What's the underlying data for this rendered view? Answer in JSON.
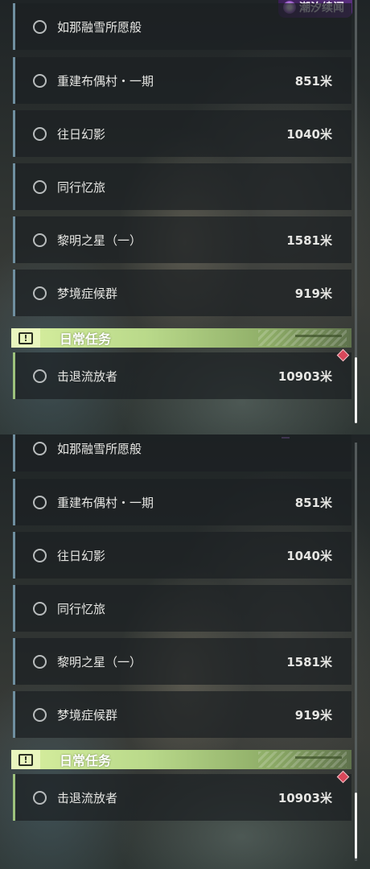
{
  "logo": {
    "text": "潮汐续闻"
  },
  "quests": [
    {
      "name": "如那融雪所愿般",
      "distance": ""
    },
    {
      "name": "重建布偶村・一期",
      "distance": "851米"
    },
    {
      "name": "往日幻影",
      "distance": "1040米"
    },
    {
      "name": "同行忆旅",
      "distance": ""
    },
    {
      "name": "黎明之星（一）",
      "distance": "1581米"
    },
    {
      "name": "梦境症候群",
      "distance": "919米"
    }
  ],
  "daily_section": {
    "label": "日常任务"
  },
  "daily_quests": [
    {
      "name": "击退流放者",
      "distance": "10903米"
    }
  ],
  "colors": {
    "main_quest_accent": "#6f8fa0",
    "daily_accent": "#9dc27c",
    "tracker_marker": "#d9475a",
    "logo_purple": "#5a2f7f"
  },
  "icons": {
    "status": "radio-circle-icon",
    "section": "exclamation-box-icon",
    "tracker": "red-diamond-icon",
    "logo": "tide-logo-icon"
  }
}
